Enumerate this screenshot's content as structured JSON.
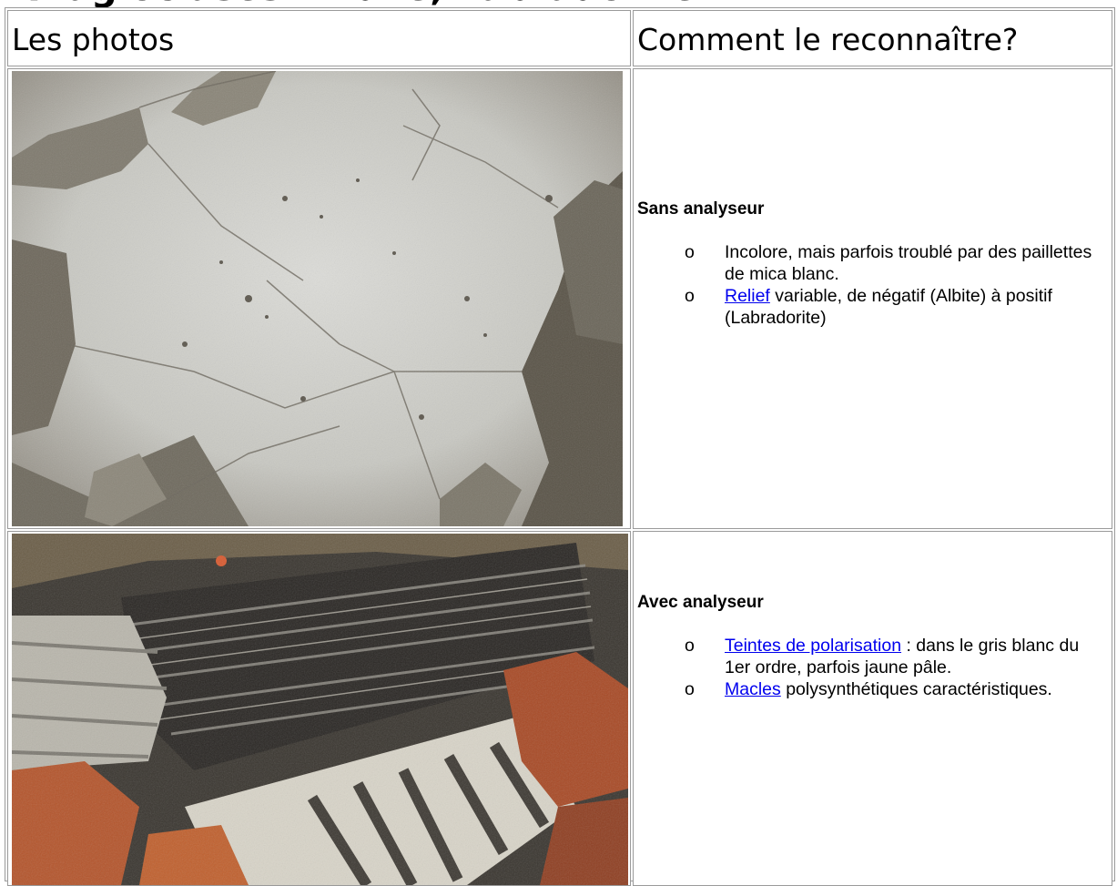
{
  "page": {
    "heading": "Plagioclases: Albite, Labradorite"
  },
  "table": {
    "header_photos": "Les photos",
    "header_recognize": "Comment le reconnaître?"
  },
  "row1": {
    "title": "Sans analyseur",
    "item1": "Incolore, mais parfois troublé par des paillettes de mica blanc.",
    "item2_link": "Relief",
    "item2_text": " variable, de négatif (Albite) à positif (Labradorite)",
    "photo_icon": "thin-section-plane-polarized-photo"
  },
  "row2": {
    "title": "Avec analyseur",
    "item1_link": "Teintes de polarisation",
    "item1_text": " : dans le gris blanc du 1er ordre, parfois jaune pâle.",
    "item2_link": "Macles",
    "item2_text": " polysynthétiques caractéristiques.",
    "photo_icon": "thin-section-cross-polarized-photo"
  },
  "bullet_glyph": "o"
}
